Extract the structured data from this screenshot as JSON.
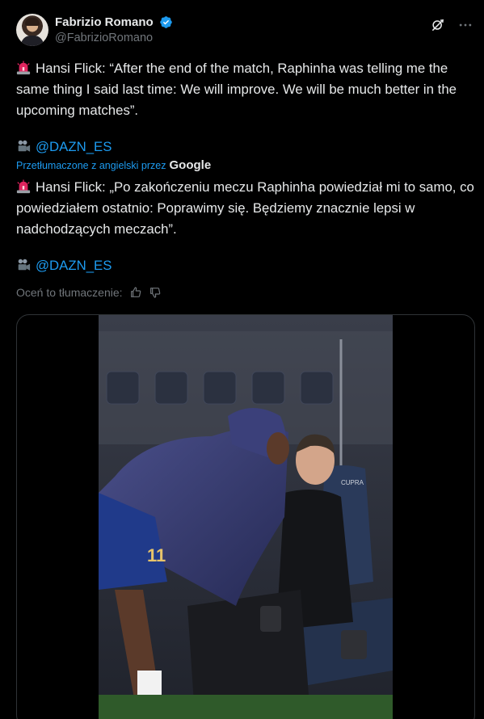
{
  "author": {
    "display_name": "Fabrizio Romano",
    "handle": "@FabrizioRomano"
  },
  "tweet": {
    "original_text": "Hansi Flick: “After the end of the match, Raphinha was telling me the same thing I said last time: We will improve. We will be much better in the upcoming matches”.",
    "original_credit": "@DAZN_ES",
    "translated_label": "Przetłumaczone z angielski przez",
    "translator": "Google",
    "translated_text": "Hansi Flick: „Po zakończeniu meczu Raphinha powiedział mi to samo, co powiedziałem ostatnio: Poprawimy się. Będziemy znacznie lepsi w nadchodzących meczach”.",
    "translated_credit": "@DAZN_ES",
    "rate_label": "Oceń to tłumaczenie:"
  },
  "media": {
    "seat_logo": "CUPRA"
  },
  "colors": {
    "background": "#000000",
    "text": "#e7e9ea",
    "secondary": "#71767b",
    "accent": "#1d9bf0",
    "border": "#2f3336"
  },
  "icons": {
    "verified": "verified-badge-icon",
    "grok": "grok-icon",
    "more": "more-icon",
    "siren": "siren-emoji-icon",
    "camera": "movie-camera-emoji-icon",
    "thumbs_up": "thumbs-up-icon",
    "thumbs_down": "thumbs-down-icon"
  }
}
